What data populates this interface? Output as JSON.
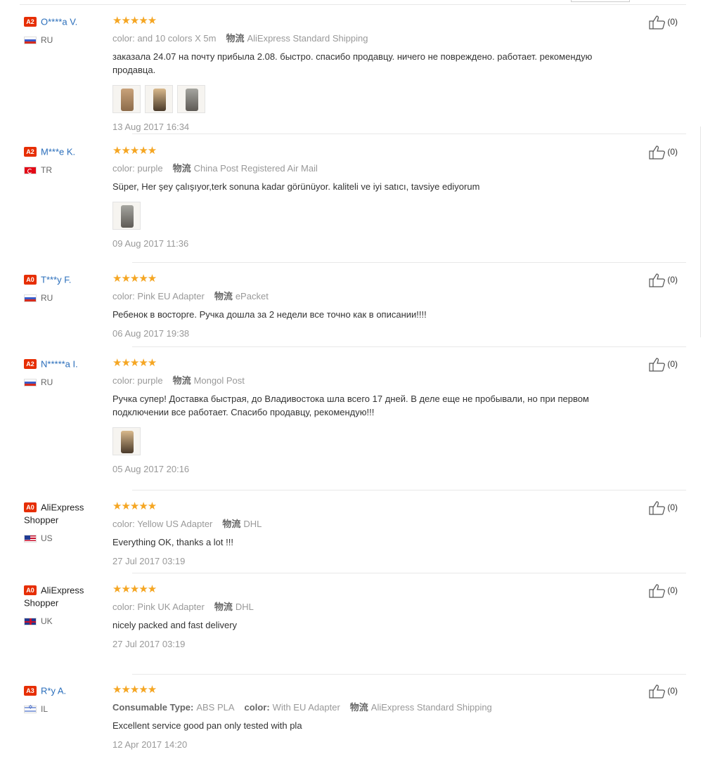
{
  "reviews": [
    {
      "badge": "A2",
      "name": "O****a V.",
      "country": "RU",
      "flag": "ru",
      "stars": "★★★★★",
      "color_label": "color:",
      "color_value": "and 10 colors X 5m",
      "ship_label": "物流",
      "ship_value": "AliExpress Standard Shipping",
      "text": "заказала 24.07 на почту прибыла 2.08. быстро. спасибо продавцу. ничего не повреждено. работает. рекомендую продавца.",
      "photos": 3,
      "date": "13 Aug 2017 16:34",
      "likes": "(0)"
    },
    {
      "badge": "A2",
      "name": "M***e K.",
      "country": "TR",
      "flag": "tr",
      "stars": "★★★★★",
      "color_label": "color:",
      "color_value": "purple",
      "ship_label": "物流",
      "ship_value": "China Post Registered Air Mail",
      "text": "Süper, Her şey çalışıyor,terk sonuna kadar görünüyor. kaliteli ve iyi satıcı, tavsiye ediyorum",
      "photos": 1,
      "date": "09 Aug 2017 11:36",
      "likes": "(0)"
    },
    {
      "badge": "A0",
      "name": "T***y F.",
      "country": "RU",
      "flag": "ru",
      "stars": "★★★★★",
      "color_label": "color:",
      "color_value": "Pink EU Adapter",
      "ship_label": "物流",
      "ship_value": "ePacket",
      "text": "Ребенок в восторге. Ручка дошла за 2 недели все точно как в описании!!!!",
      "photos": 0,
      "date": "06 Aug 2017 19:38",
      "likes": "(0)"
    },
    {
      "badge": "A2",
      "name": "N*****a I.",
      "country": "RU",
      "flag": "ru",
      "stars": "★★★★★",
      "color_label": "color:",
      "color_value": "purple",
      "ship_label": "物流",
      "ship_value": "Mongol Post",
      "text": "Ручка супер! Доставка быстрая, до Владивостока шла всего 17 дней. В деле еще не пробывали, но при первом подключении все работает. Спасибо продавцу, рекомендую!!!",
      "photos": 1,
      "date": "05 Aug 2017 20:16",
      "likes": "(0)"
    },
    {
      "badge": "A0",
      "name": "AliExpress Shopper",
      "country": "US",
      "flag": "us",
      "stars": "★★★★★",
      "color_label": "color:",
      "color_value": "Yellow US Adapter",
      "ship_label": "物流",
      "ship_value": "DHL",
      "text": "Everything OK, thanks a lot !!!",
      "photos": 0,
      "date": "27 Jul 2017 03:19",
      "likes": "(0)"
    },
    {
      "badge": "A0",
      "name": "AliExpress Shopper",
      "country": "UK",
      "flag": "uk",
      "stars": "★★★★★",
      "color_label": "color:",
      "color_value": "Pink UK Adapter",
      "ship_label": "物流",
      "ship_value": "DHL",
      "text": "nicely packed and fast delivery",
      "photos": 0,
      "date": "27 Jul 2017 03:19",
      "likes": "(0)"
    },
    {
      "badge": "A3",
      "name": "R*y A.",
      "country": "IL",
      "flag": "il",
      "stars": "★★★★★",
      "consumable_label": "Consumable Type:",
      "consumable_value": "ABS PLA",
      "color_label": "color:",
      "color_value": "With EU Adapter",
      "ship_label": "物流",
      "ship_value": "AliExpress Standard Shipping",
      "text": "Excellent service good pan only tested with pla",
      "photos": 0,
      "date": "12 Apr 2017 14:20",
      "likes": "(0)"
    }
  ]
}
